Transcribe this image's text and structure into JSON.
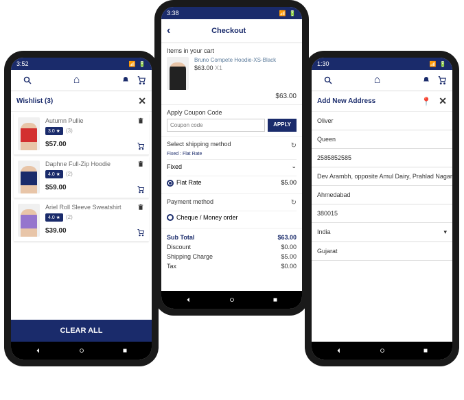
{
  "phone1": {
    "time": "3:52",
    "header_title": "Wishlist (3)",
    "items": [
      {
        "name": "Autumn Pullie",
        "rating": "3.0 ★",
        "count": "(3)",
        "price": "$57.00"
      },
      {
        "name": "Daphne Full-Zip Hoodie",
        "rating": "4.0 ★",
        "count": "(2)",
        "price": "$59.00"
      },
      {
        "name": "Ariel Roll Sleeve Sweatshirt",
        "rating": "4.0 ★",
        "count": "(2)",
        "price": "$39.00"
      }
    ],
    "clear": "CLEAR ALL"
  },
  "phone2": {
    "time": "3:38",
    "title": "Checkout",
    "cart_title": "Items in your cart",
    "item": {
      "name": "Bruno Compete Hoodie-XS-Black",
      "unit": "$63.00",
      "qty": "X1",
      "total": "$63.00"
    },
    "coupon_title": "Apply Coupon Code",
    "coupon_placeholder": "Coupon code",
    "apply": "APPLY",
    "ship_title": "Select shipping method",
    "ship_fixed": "Fixed : Flat Rate",
    "ship_label": "Fixed",
    "ship_option": "Flat Rate",
    "ship_price": "$5.00",
    "pay_title": "Payment method",
    "pay_option": "Cheque / Money order",
    "totals": [
      {
        "label": "Sub Total",
        "value": "$63.00",
        "bold": true
      },
      {
        "label": "Discount",
        "value": "$0.00"
      },
      {
        "label": "Shipping Charge",
        "value": "$5.00"
      },
      {
        "label": "Tax",
        "value": "$0.00"
      }
    ]
  },
  "phone3": {
    "time": "1:30",
    "title": "Add New Address",
    "fields": [
      "Oliver",
      "Queen",
      "2585852585",
      "Dev Arambh, opposite Amul Dairy, Prahlad Nagar, Ahmedaba",
      "Ahmedabad",
      "380015",
      "India",
      "Gujarat"
    ]
  }
}
